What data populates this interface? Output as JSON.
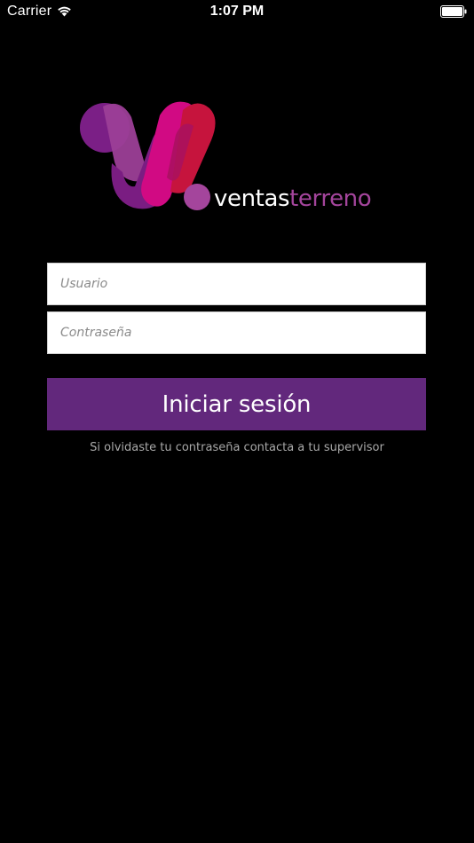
{
  "status_bar": {
    "carrier": "Carrier",
    "time": "1:07 PM"
  },
  "logo": {
    "word_1": "ventas",
    "word_2": "terreno",
    "accent_color": "#a4459c",
    "icon": "ventasterreno-logo-mark"
  },
  "form": {
    "username_placeholder": "Usuario",
    "password_placeholder": "Contraseña",
    "login_label": "Iniciar sesión",
    "button_color": "#62287c",
    "hint": "Si olvidaste tu contraseña contacta a tu supervisor"
  }
}
